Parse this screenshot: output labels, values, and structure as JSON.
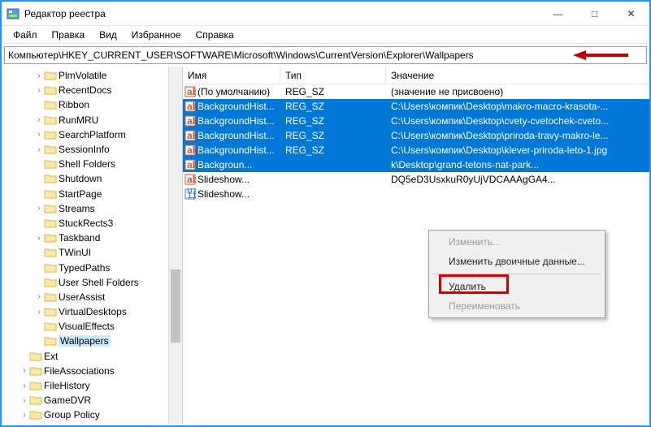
{
  "window": {
    "title": "Редактор реестра",
    "min": "—",
    "max": "□",
    "close": "✕"
  },
  "menu": [
    "Файл",
    "Правка",
    "Вид",
    "Избранное",
    "Справка"
  ],
  "address": "Компьютер\\HKEY_CURRENT_USER\\SOFTWARE\\Microsoft\\Windows\\CurrentVersion\\Explorer\\Wallpapers",
  "tree": [
    {
      "indent": 2,
      "tw": "›",
      "label": "PlmVolatile"
    },
    {
      "indent": 2,
      "tw": "›",
      "label": "RecentDocs"
    },
    {
      "indent": 2,
      "tw": " ",
      "label": "Ribbon"
    },
    {
      "indent": 2,
      "tw": "›",
      "label": "RunMRU"
    },
    {
      "indent": 2,
      "tw": "›",
      "label": "SearchPlatform"
    },
    {
      "indent": 2,
      "tw": "›",
      "label": "SessionInfo"
    },
    {
      "indent": 2,
      "tw": " ",
      "label": "Shell Folders"
    },
    {
      "indent": 2,
      "tw": " ",
      "label": "Shutdown"
    },
    {
      "indent": 2,
      "tw": " ",
      "label": "StartPage"
    },
    {
      "indent": 2,
      "tw": "›",
      "label": "Streams"
    },
    {
      "indent": 2,
      "tw": " ",
      "label": "StuckRects3"
    },
    {
      "indent": 2,
      "tw": "›",
      "label": "Taskband"
    },
    {
      "indent": 2,
      "tw": " ",
      "label": "TWinUI"
    },
    {
      "indent": 2,
      "tw": " ",
      "label": "TypedPaths"
    },
    {
      "indent": 2,
      "tw": " ",
      "label": "User Shell Folders"
    },
    {
      "indent": 2,
      "tw": "›",
      "label": "UserAssist"
    },
    {
      "indent": 2,
      "tw": "›",
      "label": "VirtualDesktops"
    },
    {
      "indent": 2,
      "tw": " ",
      "label": "VisualEffects"
    },
    {
      "indent": 2,
      "tw": " ",
      "label": "Wallpapers",
      "sel": true
    },
    {
      "indent": 1,
      "tw": " ",
      "label": "Ext"
    },
    {
      "indent": 1,
      "tw": "›",
      "label": "FileAssociations"
    },
    {
      "indent": 1,
      "tw": "›",
      "label": "FileHistory"
    },
    {
      "indent": 1,
      "tw": "›",
      "label": "GameDVR"
    },
    {
      "indent": 1,
      "tw": "›",
      "label": "Group Policy"
    }
  ],
  "columns": {
    "name": "Имя",
    "type": "Тип",
    "value": "Значение"
  },
  "rows": [
    {
      "icon": "ab",
      "sel": false,
      "name": "(По умолчанию)",
      "type": "REG_SZ",
      "value": "(значение не присвоено)"
    },
    {
      "icon": "ab",
      "sel": true,
      "name": "BackgroundHist...",
      "type": "REG_SZ",
      "value": "C:\\Users\\компик\\Desktop\\makro-macro-krasota-..."
    },
    {
      "icon": "ab",
      "sel": true,
      "name": "BackgroundHist...",
      "type": "REG_SZ",
      "value": "C:\\Users\\компик\\Desktop\\cvety-cvetochek-cveto..."
    },
    {
      "icon": "ab",
      "sel": true,
      "name": "BackgroundHist...",
      "type": "REG_SZ",
      "value": "C:\\Users\\компик\\Desktop\\priroda-travy-makro-le..."
    },
    {
      "icon": "ab",
      "sel": true,
      "name": "BackgroundHist...",
      "type": "REG_SZ",
      "value": "C:\\Users\\компик\\Desktop\\klever-priroda-leto-1.jpg"
    },
    {
      "icon": "ab",
      "sel": true,
      "name": "Backgroun...",
      "type": "",
      "value": "k\\Desktop\\grand-tetons-nat-park..."
    },
    {
      "icon": "ab",
      "sel": false,
      "name": "Slideshow...",
      "type": "",
      "value": "DQ5eD3UsxkuR0yUjVDCAAAgGA4..."
    },
    {
      "icon": "bin",
      "sel": false,
      "name": "Slideshow...",
      "type": "",
      "value": ""
    }
  ],
  "context": {
    "edit": "Изменить...",
    "editbin": "Изменить двоичные данные...",
    "delete": "Удалить",
    "rename": "Переименовать"
  },
  "colors": {
    "accent": "#0078d7",
    "highlight": "#d40000"
  }
}
